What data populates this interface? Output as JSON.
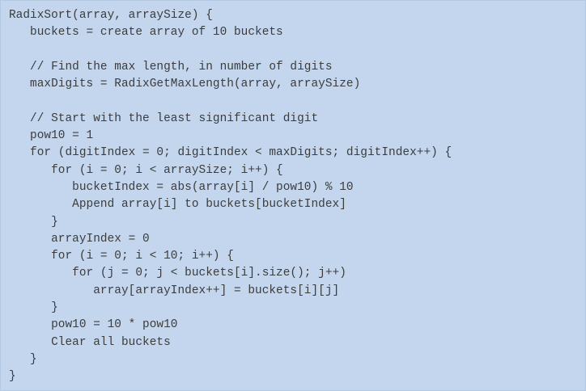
{
  "code": {
    "lines": [
      "RadixSort(array, arraySize) {",
      "   buckets = create array of 10 buckets",
      "",
      "   // Find the max length, in number of digits",
      "   maxDigits = RadixGetMaxLength(array, arraySize)",
      "",
      "   // Start with the least significant digit",
      "   pow10 = 1",
      "   for (digitIndex = 0; digitIndex < maxDigits; digitIndex++) {",
      "      for (i = 0; i < arraySize; i++) {",
      "         bucketIndex = abs(array[i] / pow10) % 10",
      "         Append array[i] to buckets[bucketIndex]",
      "      }",
      "      arrayIndex = 0",
      "      for (i = 0; i < 10; i++) {",
      "         for (j = 0; j < buckets[i].size(); j++)",
      "            array[arrayIndex++] = buckets[i][j]",
      "      }",
      "      pow10 = 10 * pow10",
      "      Clear all buckets",
      "   }",
      "}"
    ]
  }
}
